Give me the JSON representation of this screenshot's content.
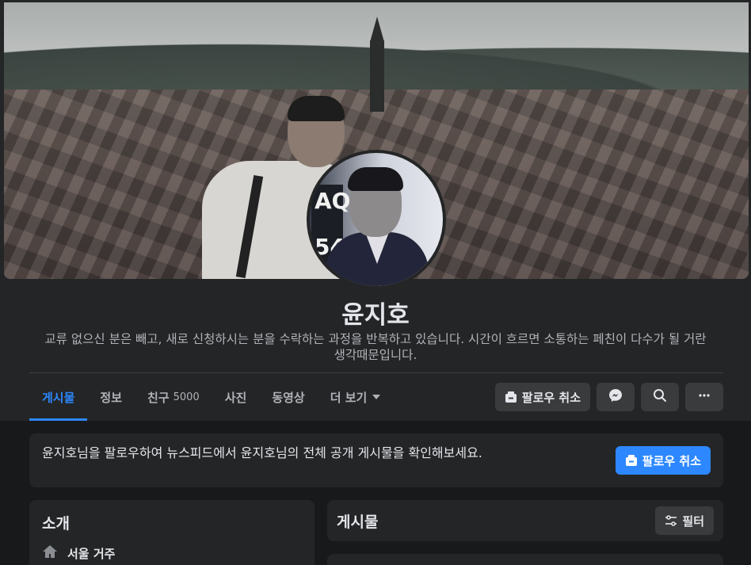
{
  "profile": {
    "name": "윤지호",
    "bio": "교류 없으신 분은 빼고, 새로 신청하시는 분을 수락하는 과정을 반복하고 있습니다. 시간이 흐르면 소통하는 페친이 다수가 될 거란 생각때문입니다."
  },
  "tabs": [
    {
      "label": "게시물",
      "active": true
    },
    {
      "label": "정보"
    },
    {
      "label": "친구",
      "count": "5000"
    },
    {
      "label": "사진"
    },
    {
      "label": "동영상"
    },
    {
      "label": "더 보기"
    }
  ],
  "actions": {
    "unfollow_label": "팔로우 취소",
    "messenger_icon": "messenger-icon",
    "search_icon": "search-icon",
    "more_icon": "more-icon"
  },
  "follow_card": {
    "message": "윤지호님을 팔로우하여 뉴스피드에서 윤지호님의 전체 공개 게시물을 확인해보세요.",
    "button_label": "팔로우 취소"
  },
  "intro": {
    "title": "소개",
    "location": "서울 거주"
  },
  "posts": {
    "title": "게시물",
    "filter_label": "필터"
  },
  "colors": {
    "accent": "#2d88ff",
    "background": "#18191a",
    "card": "#242526",
    "button": "#3a3b3c"
  }
}
